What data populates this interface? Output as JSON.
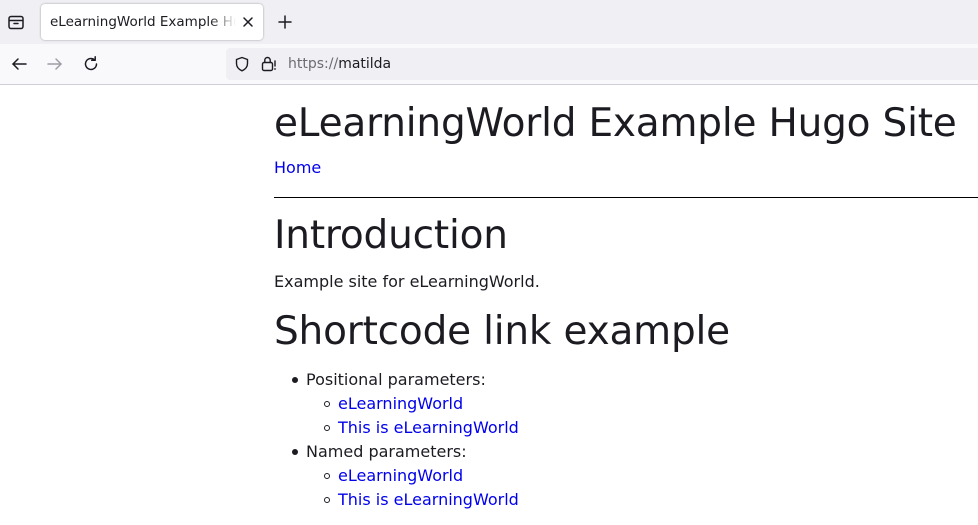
{
  "browser": {
    "tab_title": "eLearningWorld Example Hugo Site",
    "url_scheme": "https://",
    "url_host": "matilda"
  },
  "page": {
    "site_title": "eLearningWorld Example Hugo Site",
    "nav_home": "Home",
    "intro_heading": "Introduction",
    "intro_text": "Example site for eLearningWorld.",
    "shortcode_heading": "Shortcode link example",
    "groups": [
      {
        "label": "Positional parameters:",
        "links": [
          "eLearningWorld",
          "This is eLearningWorld"
        ]
      },
      {
        "label": "Named parameters:",
        "links": [
          "eLearningWorld",
          "This is eLearningWorld"
        ]
      }
    ]
  },
  "colors": {
    "link": "#0000ee",
    "text": "#1c1b22",
    "chrome": "#f0f0f4"
  }
}
